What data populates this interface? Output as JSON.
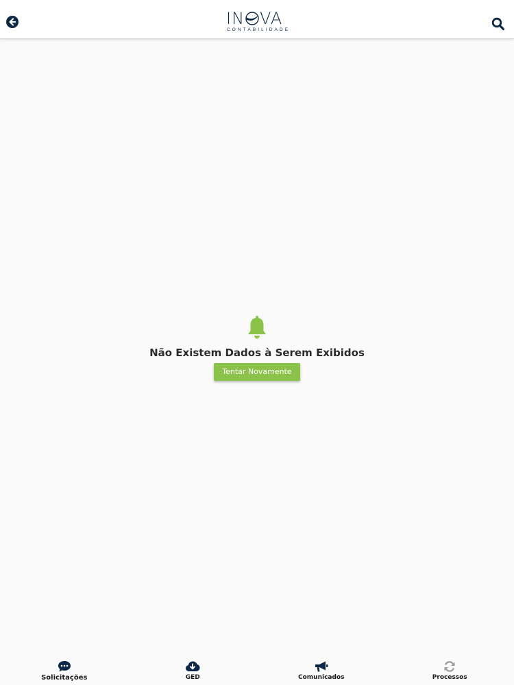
{
  "header": {
    "logo_word_start": "IN",
    "logo_word_end": "VA",
    "logo_subtitle": "CONTABILIDADE",
    "brand_color": "#0d2847",
    "back_icon": "arrow-left-circle-icon",
    "search_icon": "search-icon"
  },
  "empty_state": {
    "icon": "bell-icon",
    "icon_color": "#8bc34a",
    "message": "Não Existem Dados à Serem Exibidos",
    "retry_label": "Tentar Novamente",
    "accent_color": "#8bc34a"
  },
  "bottom_nav": {
    "items": [
      {
        "label": "Solicitações",
        "icon": "comment-dots-icon",
        "icon_color": "#0d2847"
      },
      {
        "label": "GED",
        "icon": "cloud-download-icon",
        "icon_color": "#0d2847"
      },
      {
        "label": "Comunicados",
        "icon": "bullhorn-icon",
        "icon_color": "#0d2847"
      },
      {
        "label": "Processos",
        "icon": "sync-icon",
        "icon_color": "#9e9e9e"
      }
    ]
  }
}
